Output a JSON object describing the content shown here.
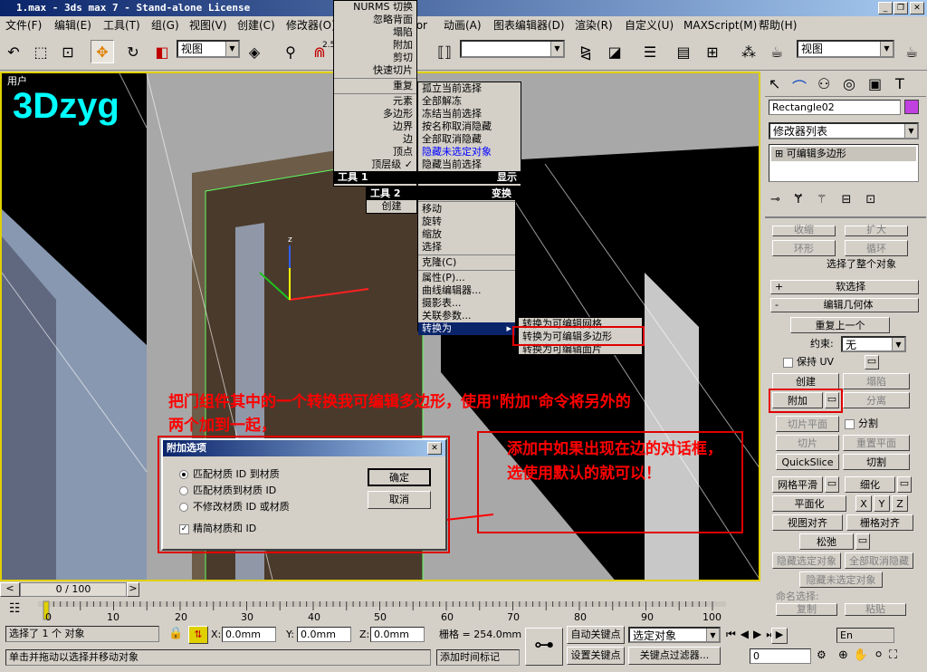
{
  "window": {
    "title": "1.max - 3ds max 7  - Stand-alone License"
  },
  "menubar": [
    "文件(F)",
    "编辑(E)",
    "工具(T)",
    "组(G)",
    "视图(V)",
    "创建(C)",
    "修改器(O)",
    "tor",
    "动画(A)",
    "图表编辑器(D)",
    "渲染(R)",
    "自定义(U)",
    "MAXScript(M)",
    "帮助(H)"
  ],
  "toolbar": {
    "view_dropdown": "视图",
    "selection_set": "",
    "view_dropdown2": "视图",
    "snap_label": "2.5"
  },
  "viewport": {
    "label": "用户",
    "watermark": "3Dzyg",
    "axis_z": "z"
  },
  "quad_menu_left": {
    "rows": [
      "NURMS 切换",
      "忽略背面",
      "塌陷",
      "附加",
      "剪切",
      "快速切片",
      "重复",
      "元素",
      "多边形",
      "边界",
      "边",
      "顶点",
      "顶层级 ✓"
    ],
    "header1": "工具 1",
    "header2": "工具 2",
    "create": "创建"
  },
  "quad_menu_right": {
    "display_rows": [
      "孤立当前选择",
      "全部解冻",
      "冻结当前选择",
      "按名称取消隐藏",
      "全部取消隐藏",
      "隐藏未选定对象",
      "隐藏当前选择"
    ],
    "display_header": "显示",
    "transform_header": "变换",
    "transform_rows": [
      "移动",
      "旋转",
      "缩放",
      "选择",
      "克隆(C)",
      "属性(P)...",
      "曲线编辑器...",
      "摄影表...",
      "关联参数...",
      "转换为"
    ]
  },
  "convert_submenu": [
    "转换为可编辑网格",
    "转换为可编辑多边形",
    "转换为可编辑面片"
  ],
  "right_panel": {
    "object_name": "Rectangle02",
    "modifier_list": "修改器列表",
    "stack_item": "可编辑多边形",
    "ghost_buttons": [
      "收缩",
      "扩大"
    ],
    "ring": "环形",
    "loop": "循环",
    "selected_whole": "选择了整个对象",
    "soft_select": "软选择",
    "edit_geometry": "编辑几何体",
    "repeat_last": "重复上一个",
    "constraint_label": "约束:",
    "constraint_value": "无",
    "preserve_uv": "保持 UV",
    "create": "创建",
    "collapse": "塌陷",
    "attach": "附加",
    "detach": "分离",
    "slice_plane": "切片平面",
    "split": "分割",
    "slice": "切片",
    "reset_plane": "重置平面",
    "quickslice": "QuickSlice",
    "cut": "切割",
    "meshsmooth": "网格平滑",
    "tessellate": "细化",
    "planarize": "平面化",
    "x": "X",
    "y": "Y",
    "z": "Z",
    "view_align": "视图对齐",
    "grid_align": "栅格对齐",
    "relax": "松弛",
    "hide_selected": "隐藏选定对象",
    "unhide_all": "全部取消隐藏",
    "hide_unselected": "隐藏未选定对象",
    "named_sel": "命名选择:",
    "copy": "复制",
    "paste": "粘贴"
  },
  "dialog": {
    "title": "附加选项",
    "options": [
      "匹配材质 ID 到材质",
      "匹配材质到材质 ID",
      "不修改材质 ID 或材质"
    ],
    "condense": "精简材质和 ID",
    "ok": "确定",
    "cancel": "取消"
  },
  "annotations": {
    "main": "把门组件其中的一个转换我可编辑多边形，使用\"附加\"命令将另外的两个加到一起，",
    "side": "添加中如果出现在边的对话框，选使用默认的就可以！"
  },
  "timeline": {
    "frame": "0 / 100",
    "ticks": [
      "0",
      "10",
      "20",
      "30",
      "40",
      "50",
      "60",
      "70",
      "80",
      "90",
      "100"
    ]
  },
  "status": {
    "selected": "选择了 1 个 对象",
    "x_val": "0.0mm",
    "y_val": "0.0mm",
    "z_val": "0.0mm",
    "x_lbl": "X:",
    "y_lbl": "Y:",
    "z_lbl": "Z:",
    "grid": "栅格 = 254.0mm",
    "prompt": "单击并拖动以选择并移动对象",
    "add_time_tag": "添加时间标记",
    "auto_key": "自动关键点",
    "set_key": "设置关键点",
    "key_filter": "关键点过滤器...",
    "selected_obj": "选定对象",
    "frame_field": "0",
    "lang": "En"
  },
  "colors": {
    "title_blue": "#0a246a",
    "annotation_red": "#ff0000",
    "watermark_cyan": "#00ffff",
    "object_brown": "#4a3a2c"
  }
}
